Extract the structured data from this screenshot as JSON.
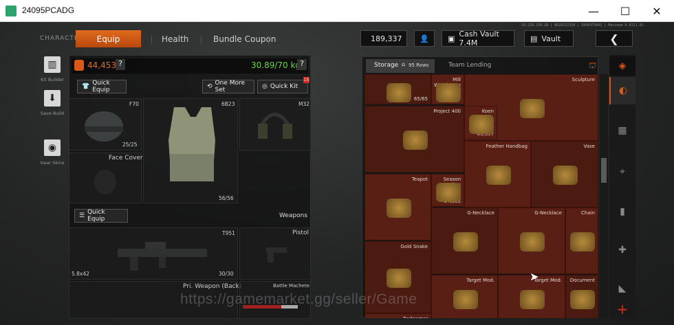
{
  "window": {
    "title": "24095PCADG",
    "controls": [
      "—",
      "☐",
      "✕"
    ]
  },
  "nav": {
    "character": "CHARACTER",
    "tabs": [
      "Equip",
      "Health",
      "Bundle Coupon"
    ]
  },
  "currency": {
    "koen": "189,337",
    "cash_vault": "Cash Vault 7.4M",
    "vault": "Vault"
  },
  "server_info": "10.228.239.28 | 8628132310 | 3439375842 | Maximum 6.0111.01",
  "sidebar": [
    "Kit Builder",
    "Save Build",
    "Gear Skins"
  ],
  "equip": {
    "armor_value": "44,453",
    "weight": "30.89/70 kg",
    "quick_equip": "Quick Equip",
    "one_more_set": "One More Set",
    "quick_kit": "Quick Kit",
    "quick_kit_badge": "15"
  },
  "slots": {
    "helmet": {
      "name": "F70",
      "dur": "25/25"
    },
    "face": {
      "name": "Face Cover"
    },
    "vest": {
      "name": "6B23",
      "dur": "56/56"
    },
    "headset": {
      "name": "M32"
    }
  },
  "weapons": {
    "quick_equip": "Quick Equip",
    "header": "Weapons",
    "primary": {
      "name": "T951",
      "ammo": "5.8x42",
      "dur": "30/30"
    },
    "pistol": "Pistol",
    "back": "Pri. Weapon (Back)",
    "melee": "Battle Machete"
  },
  "storage": {
    "tab": "Storage",
    "rows": "95 Rows",
    "team": "Team Lending"
  },
  "items": [
    {
      "name": "",
      "qty": "65/65"
    },
    {
      "name": "Mill Warehouse",
      "qty": "8/10"
    },
    {
      "name": "Sculpture",
      "qty": ""
    },
    {
      "name": "Project 400",
      "qty": ""
    },
    {
      "name": "Koen",
      "qty": "89,337"
    },
    {
      "name": "Feather Handbag",
      "qty": ""
    },
    {
      "name": "Vase",
      "qty": ""
    },
    {
      "name": "Teapot",
      "qty": ""
    },
    {
      "name": "Season Token",
      "qty": "34,055"
    },
    {
      "name": "G-Necklace",
      "qty": ""
    },
    {
      "name": "G-Necklace",
      "qty": ""
    },
    {
      "name": "Chain",
      "qty": ""
    },
    {
      "name": "Gold Snake",
      "qty": ""
    },
    {
      "name": "Target Mod.",
      "qty": ""
    },
    {
      "name": "Target Mod.",
      "qty": ""
    },
    {
      "name": "Document",
      "qty": ""
    },
    {
      "name": "Redeemer",
      "qty": ""
    }
  ],
  "watermark": "https://gamemarket.gg/seller/Game",
  "colors": {
    "accent": "#d9581a",
    "weight_green": "#6bd34a",
    "cell": "#5a1f14"
  },
  "icons": [
    "app-icon",
    "minimize-icon",
    "maximize-icon",
    "close-icon",
    "koen-icon",
    "profile-icon",
    "cash-vault-icon",
    "vault-icon",
    "back-arrow-icon"
  ]
}
